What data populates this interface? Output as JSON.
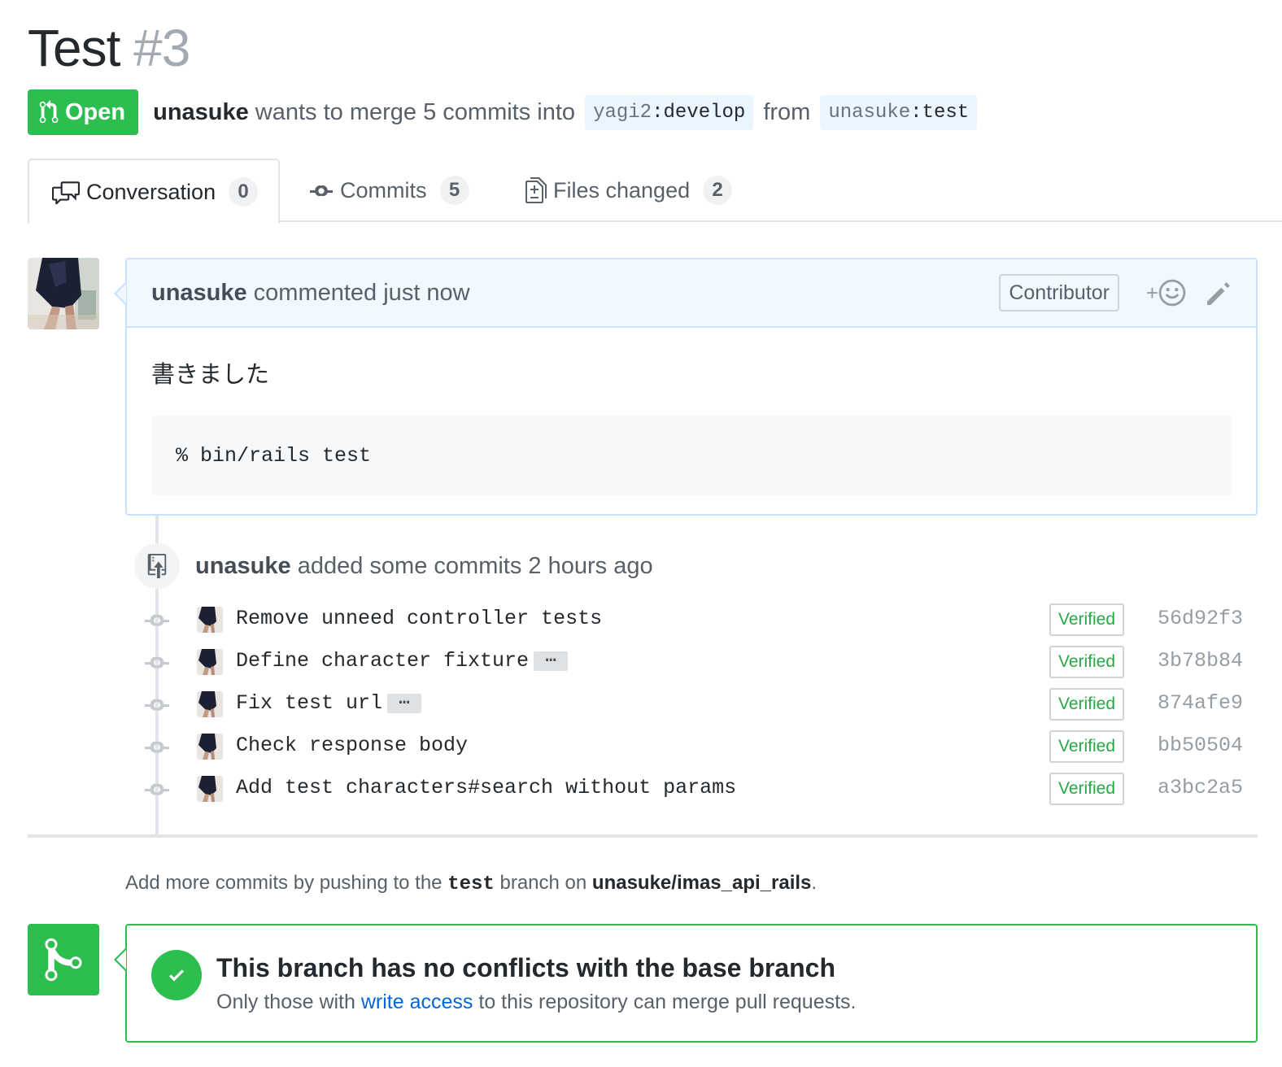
{
  "pr": {
    "title": "Test",
    "number": "#3",
    "state": "Open",
    "author": "unasuke",
    "merge_text_1": "wants to merge 5 commits into",
    "base_user": "yagi2",
    "base_branch": "develop",
    "from_text": "from",
    "head_user": "unasuke",
    "head_branch": "test"
  },
  "tabs": [
    {
      "label": "Conversation",
      "count": "0"
    },
    {
      "label": "Commits",
      "count": "5"
    },
    {
      "label": "Files changed",
      "count": "2"
    }
  ],
  "comment": {
    "author": "unasuke",
    "action": "commented just now",
    "role": "Contributor",
    "reaction_plus": "+",
    "body_text": "書きました",
    "code": "% bin/rails test"
  },
  "commit_event": {
    "author": "unasuke",
    "action": "added some commits 2 hours ago"
  },
  "commits": [
    {
      "message": "Remove unneed controller tests",
      "verified": "Verified",
      "sha": "56d92f3"
    },
    {
      "message": "Define character fixture",
      "verified": "Verified",
      "sha": "3b78b84"
    },
    {
      "message": "Fix test url",
      "verified": "Verified",
      "sha": "874afe9"
    },
    {
      "message": "Check response body",
      "verified": "Verified",
      "sha": "bb50504"
    },
    {
      "message": "Add test characters#search without params",
      "verified": "Verified",
      "sha": "a3bc2a5"
    }
  ],
  "push_hint": {
    "prefix": "Add more commits by pushing to the",
    "branch": "test",
    "middle": "branch on",
    "repo": "unasuke/imas_api_rails",
    "suffix": "."
  },
  "merge_status": {
    "heading": "This branch has no conflicts with the base branch",
    "sub_prefix": "Only those with",
    "sub_link": "write access",
    "sub_suffix": "to this repository can merge pull requests."
  },
  "colors": {
    "open_green": "#2cbe4e",
    "link_blue": "#0366d6",
    "comment_border": "#c8e1ff",
    "comment_header_bg": "#f1f8ff"
  }
}
